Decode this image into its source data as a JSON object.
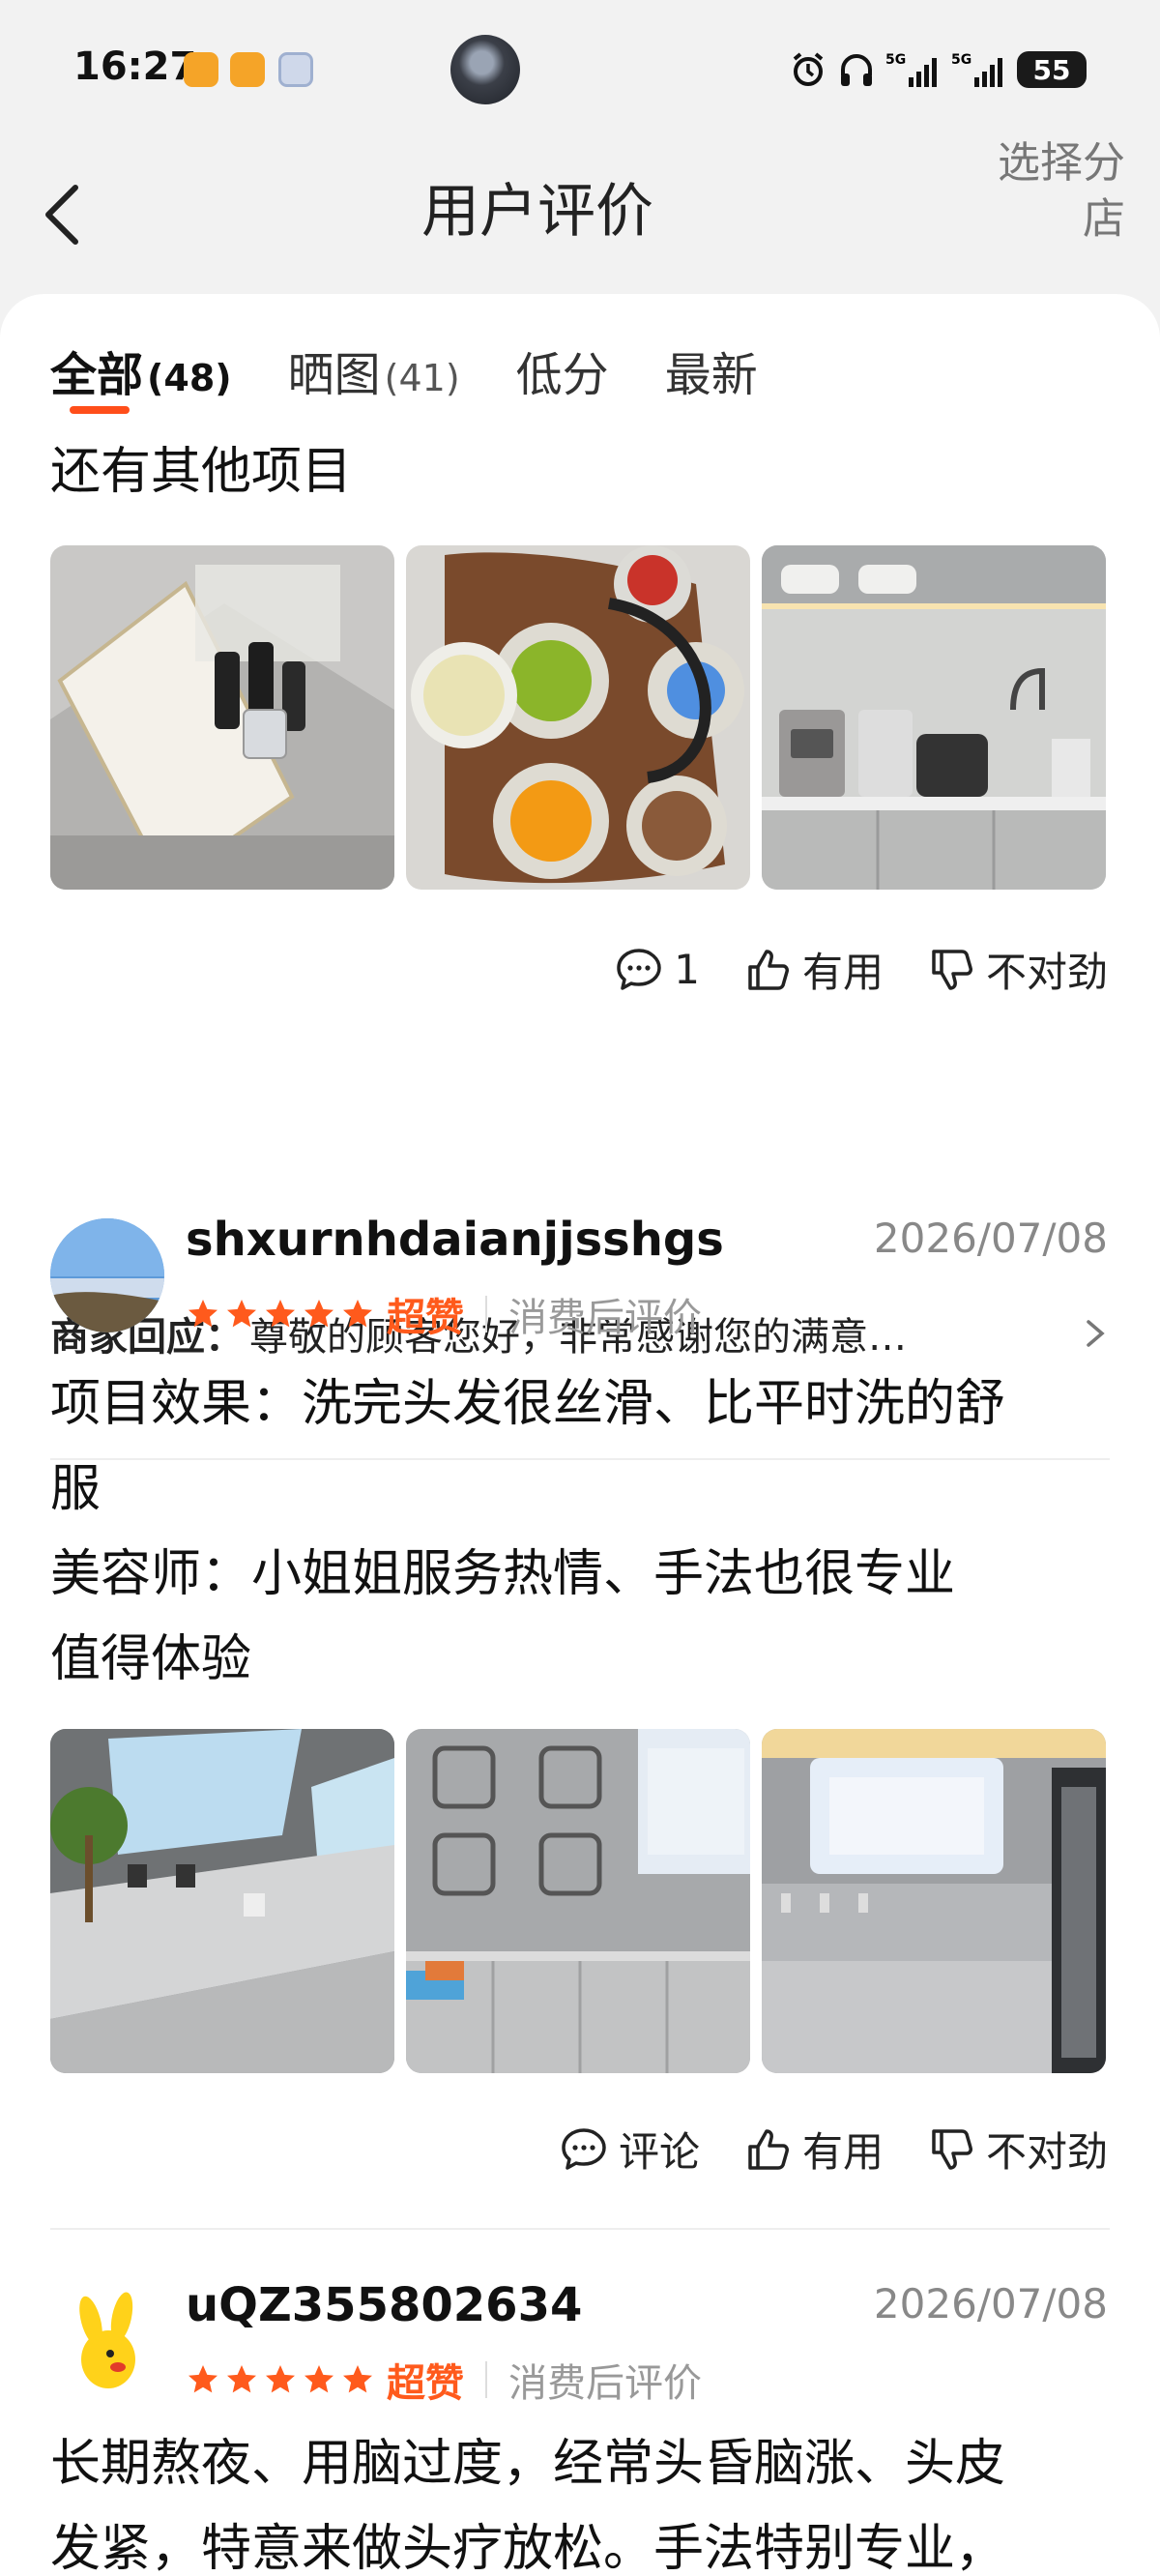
{
  "status_bar": {
    "time": "16:27",
    "battery": "55"
  },
  "header": {
    "title": "用户评价",
    "branch_line1": "选择分",
    "branch_line2": "店"
  },
  "tabs": [
    {
      "label": "全部",
      "count": "(48)"
    },
    {
      "label": "晒图",
      "count": "(41)"
    },
    {
      "label": "低分",
      "count": ""
    },
    {
      "label": "最新",
      "count": ""
    }
  ],
  "review0": {
    "text_tail": "还有其他项目",
    "actions": {
      "comment": "1",
      "useful": "有用",
      "wrong": "不对劲"
    },
    "merchant_label": "商家回应：",
    "merchant_text": "尊敬的顾客您好，非常感谢您的满意…"
  },
  "review1": {
    "user": "shxurnhdaianjjsshgs",
    "date": "2026/07/08",
    "rating_word": "超赞",
    "after_label": "消费后评价",
    "lines": [
      "项目效果：洗完头发很丝滑、比平时洗的舒",
      "服",
      "美容师：小姐姐服务热情、手法也很专业",
      "值得体验"
    ],
    "actions": {
      "comment": "评论",
      "useful": "有用",
      "wrong": "不对劲"
    }
  },
  "review2": {
    "user": "uQZ355802634",
    "date": "2026/07/08",
    "rating_word": "超赞",
    "after_label": "消费后评价",
    "lines": [
      "长期熬夜、用脑过度，经常头昏脑涨、头皮",
      "发紧，特意来做头疗放松。手法特别专业，"
    ]
  },
  "colors": {
    "accent": "#ff4e1a",
    "star": "#ff5a1c",
    "muted": "#888888"
  },
  "ratings": {
    "review1_stars": 5,
    "review2_stars": 5
  },
  "icons": [
    "back-chevron-icon",
    "comment-icon",
    "thumb-up-icon",
    "thumb-down-icon",
    "chevron-right-icon",
    "star-icon"
  ]
}
